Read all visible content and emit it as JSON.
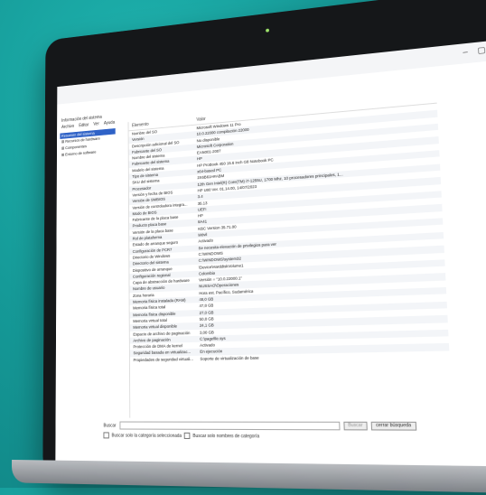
{
  "window": {
    "title": "Información del sistema",
    "menu": [
      "Archivo",
      "Editar",
      "Ver",
      "Ayuda"
    ],
    "controls": [
      "–",
      "▢",
      "✕"
    ]
  },
  "tree": [
    {
      "label": "Resumen del sistema",
      "selected": true
    },
    {
      "label": "⊞ Recursos de hardware",
      "selected": false
    },
    {
      "label": "⊞ Componentes",
      "selected": false
    },
    {
      "label": "⊞ Entorno de software",
      "selected": false
    }
  ],
  "table": {
    "headers": [
      "Elemento",
      "Valor"
    ],
    "rows": [
      [
        "Nombre del SO",
        "Microsoft Windows 11 Pro"
      ],
      [
        "Versión",
        "10.0.22000 compilación 22000"
      ],
      [
        "Descripción adicional del SO",
        "No disponible"
      ],
      [
        "Fabricante del SO",
        "Microsoft Corporation"
      ],
      [
        "Nombre del sistema",
        "EAN001-2007"
      ],
      [
        "Fabricante del sistema",
        "HP"
      ],
      [
        "Modelo del sistema",
        "HP ProBook 450 15.6 inch G8 Notebook PC"
      ],
      [
        "Tipo de sistema",
        "x64-based PC"
      ],
      [
        "SKU del sistema",
        "2X6B61H#ABM"
      ],
      [
        "Procesador",
        "12th Gen Intel(R) Core(TM) i7-1255U, 1700 Mhz, 10 procesadores principales, 1..."
      ],
      [
        "Versión y fecha de BIOS",
        "HP U80 Ver. 01.14.00, 14/07/2023"
      ],
      [
        "Versión de SMBIOS",
        "3.4"
      ],
      [
        "Versión de controladora integra...",
        "35.13"
      ],
      [
        "Modo de BIOS",
        "UEFI"
      ],
      [
        "Fabricante de la placa base",
        "HP"
      ],
      [
        "Producto placa base",
        "8A41"
      ],
      [
        "Versión de la placa base",
        "KBC Version 35.71.00"
      ],
      [
        "Rol de plataforma",
        "Móvil"
      ],
      [
        "Estado de arranque seguro",
        "Activado"
      ],
      [
        "Configuración de PCR7",
        "Se necesita elevación de privilegios para ver"
      ],
      [
        "Directorio de Windows",
        "C:\\WINDOWS"
      ],
      [
        "Directorio del sistema",
        "C:\\WINDOWS\\system32"
      ],
      [
        "Dispositivo de arranque",
        "\\Device\\HarddiskVolume1"
      ],
      [
        "Configuración regional",
        "Colombia"
      ],
      [
        "Capa de abstracción de hardware",
        "Versión = \"10.0.22000.1\""
      ],
      [
        "Nombre de usuario",
        "NUSSAO\\Operaciones"
      ],
      [
        "Zona horaria",
        "Hora est. Pacífico, Sudamérica"
      ],
      [
        "Memoria física instalada (RAM)",
        "48,0 GB"
      ],
      [
        "Memoria física total",
        "47,8 GB"
      ],
      [
        "Memoria física disponible",
        "27,0 GB"
      ],
      [
        "Memoria virtual total",
        "50,8 GB"
      ],
      [
        "Memoria virtual disponible",
        "24,1 GB"
      ],
      [
        "Espacio de archivo de paginación",
        "3,00 GB"
      ],
      [
        "Archivo de paginación",
        "C:\\pagefile.sys"
      ],
      [
        "Protección de DMA de kernel",
        "Activado"
      ],
      [
        "Seguridad basada en virtualizac...",
        "En ejecución"
      ],
      [
        "Propiedades de seguridad virtuali...",
        "Soporte de virtualización de base"
      ]
    ]
  },
  "find": {
    "label": "Buscar",
    "find_button": "Buscar",
    "close_button": "cerrar búsqueda",
    "opt1": "Buscar solo la categoría seleccionada",
    "opt2": "Buscar solo nombres de categoría"
  }
}
